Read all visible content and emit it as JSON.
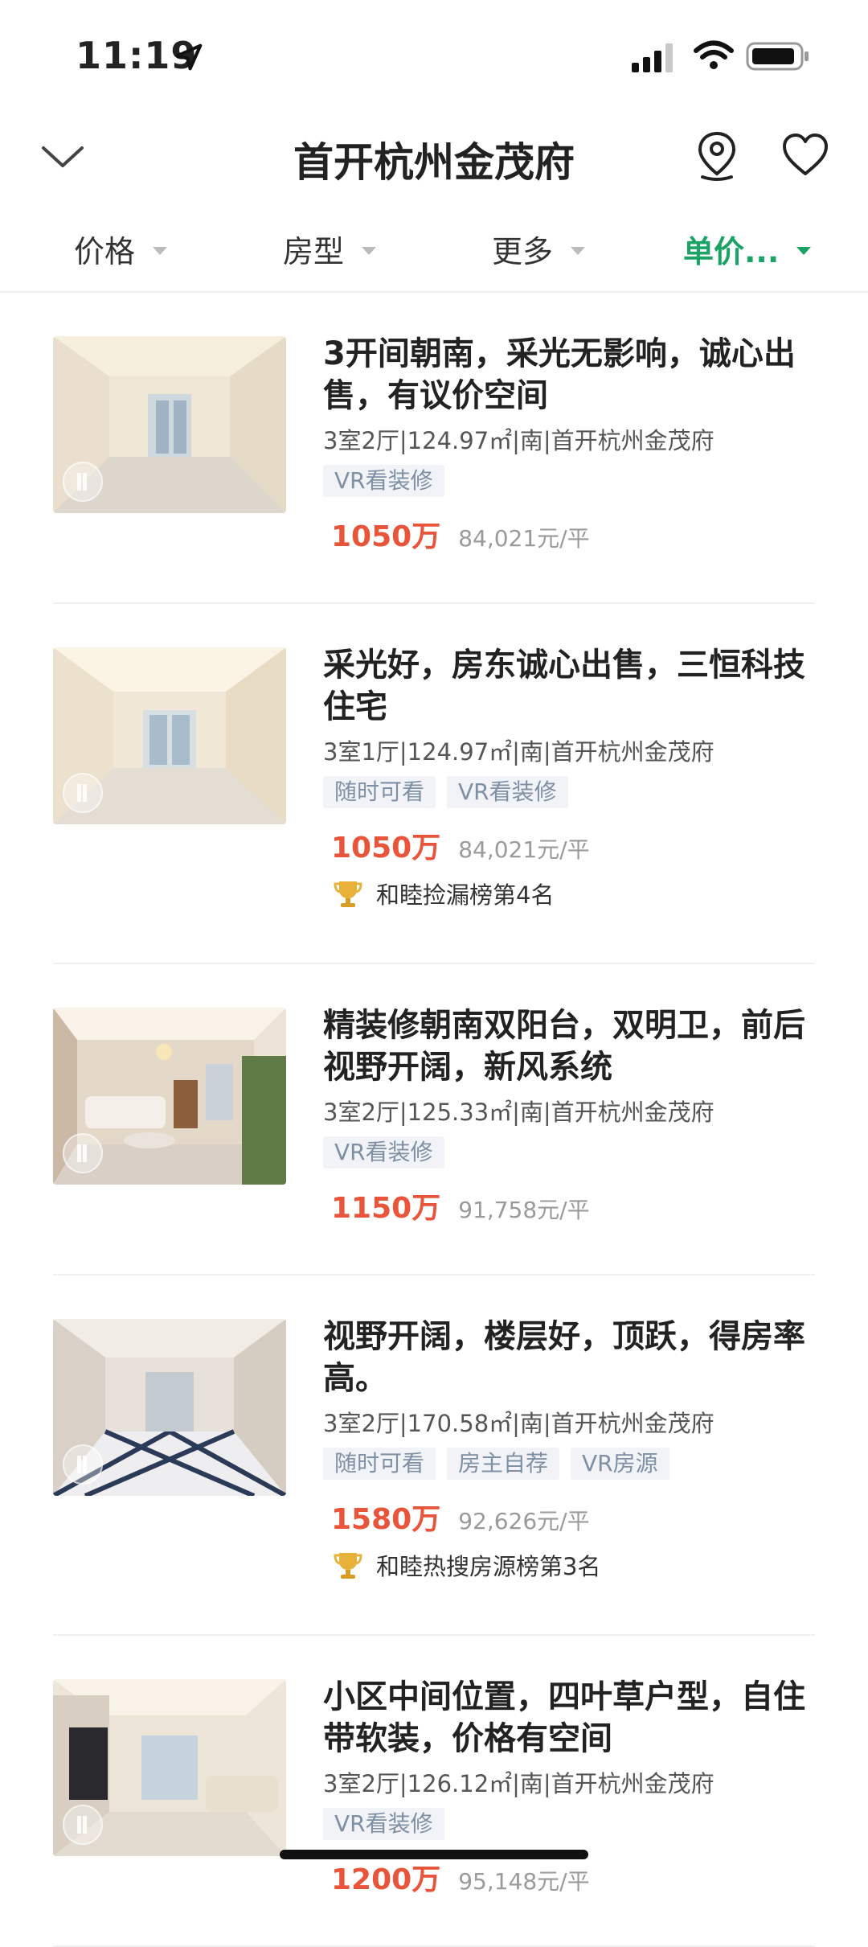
{
  "status_bar": {
    "time": "11:19"
  },
  "header": {
    "title": "首开杭州金茂府"
  },
  "filters": [
    {
      "label": "价格",
      "active": false
    },
    {
      "label": "房型",
      "active": false
    },
    {
      "label": "更多",
      "active": false
    },
    {
      "label": "单价...",
      "active": true
    }
  ],
  "listings": [
    {
      "title": "3开间朝南，采光无影响，诚心出售，有议价空间",
      "meta": "3室2厅|124.97㎡|南|首开杭州金茂府",
      "tags": [
        "VR看装修"
      ],
      "price": "1050万",
      "unit_price": "84,021元/平",
      "rank": ""
    },
    {
      "title": "采光好，房东诚心出售，三恒科技住宅",
      "meta": "3室1厅|124.97㎡|南|首开杭州金茂府",
      "tags": [
        "随时可看",
        "VR看装修"
      ],
      "price": "1050万",
      "unit_price": "84,021元/平",
      "rank": "和睦捡漏榜第4名"
    },
    {
      "title": "精装修朝南双阳台，双明卫，前后视野开阔，新风系统",
      "meta": "3室2厅|125.33㎡|南|首开杭州金茂府",
      "tags": [
        "VR看装修"
      ],
      "price": "1150万",
      "unit_price": "91,758元/平",
      "rank": ""
    },
    {
      "title": "视野开阔，楼层好，顶跃，得房率高。",
      "meta": "3室2厅|170.58㎡|南|首开杭州金茂府",
      "tags": [
        "随时可看",
        "房主自荐",
        "VR房源"
      ],
      "price": "1580万",
      "unit_price": "92,626元/平",
      "rank": "和睦热搜房源榜第3名"
    },
    {
      "title": "小区中间位置，四叶草户型，自住带软装，价格有空间",
      "meta": "3室2厅|126.12㎡|南|首开杭州金茂府",
      "tags": [
        "VR看装修"
      ],
      "price": "1200万",
      "unit_price": "95,148元/平",
      "rank": ""
    }
  ],
  "colors": {
    "accent": "#1aa365",
    "price": "#e8553a",
    "tag_bg": "#f1f3f6"
  }
}
